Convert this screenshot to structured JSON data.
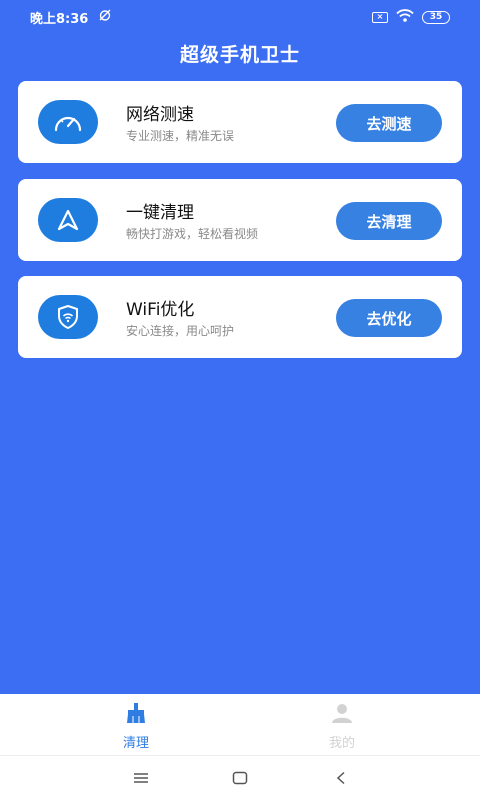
{
  "status_bar": {
    "time": "晚上8:36",
    "battery": "35"
  },
  "header": {
    "title": "超级手机卫士"
  },
  "cards": [
    {
      "title": "网络测速",
      "subtitle": "专业测速，精准无误",
      "button": "去测速",
      "icon": "speedometer-icon"
    },
    {
      "title": "一键清理",
      "subtitle": "畅快打游戏，轻松看视频",
      "button": "去清理",
      "icon": "navigation-arrow-icon"
    },
    {
      "title": "WiFi优化",
      "subtitle": "安心连接，用心呵护",
      "button": "去优化",
      "icon": "wifi-shield-icon"
    }
  ],
  "bottom_nav": {
    "tabs": [
      {
        "label": "清理",
        "icon": "broom-icon",
        "active": true
      },
      {
        "label": "我的",
        "icon": "user-icon",
        "active": false
      }
    ]
  },
  "colors": {
    "background": "#3c6ef4",
    "icon_circle": "#1f7de0",
    "button": "#3781e3",
    "active_tab": "#2f7de1",
    "inactive_tab": "#d2d2d2"
  }
}
